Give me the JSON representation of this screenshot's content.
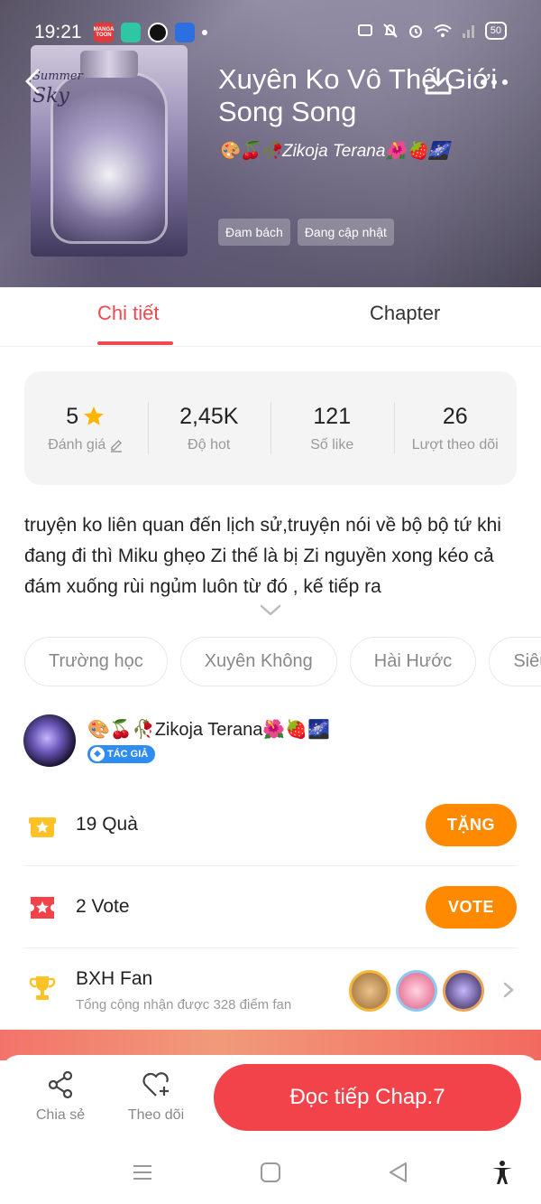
{
  "status_bar": {
    "time": "19:21",
    "battery": "50",
    "apps": [
      "MANGA TOON",
      "",
      "",
      ""
    ]
  },
  "book": {
    "title": "Xuyên Ko Vô Thế Giới Song Song",
    "author": "🎨🍒🥀Zikoja Terana🌺🍓🌌",
    "genres": [
      "Đam bách",
      "Đang cập nhật"
    ],
    "cover_text": [
      "Summer",
      "Sky"
    ]
  },
  "tabs": {
    "detail": "Chi tiết",
    "chapter": "Chapter"
  },
  "stats": {
    "rating": {
      "value": "5",
      "label": "Đánh giá"
    },
    "hot": {
      "value": "2,45K",
      "label": "Độ hot"
    },
    "likes": {
      "value": "121",
      "label": "Số like"
    },
    "follows": {
      "value": "26",
      "label": "Lượt theo dõi"
    }
  },
  "description": "truyện ko liên quan đến lịch sử,truyện nói về bộ bộ tứ khi đang đi thì Miku ghẹo Zi thế là bị Zi nguyền xong kéo cả đám xuống rùi ngủm luôn từ đó , kế tiếp ra",
  "tags": [
    "Trường học",
    "Xuyên Không",
    "Hài Hước",
    "Siêu n"
  ],
  "author_section": {
    "name": "🎨🍒🥀Zikoja Terana🌺🍓🌌",
    "badge": "TÁC GIẢ"
  },
  "gift": {
    "text": "19  Quà",
    "button": "TẶNG"
  },
  "vote": {
    "text": "2  Vote",
    "button": "VOTE"
  },
  "fan": {
    "title": "BXH Fan",
    "subtitle": "Tổng cộng nhận được 328 điểm fan"
  },
  "bottom_bar": {
    "share": "Chia sẻ",
    "follow": "Theo dõi",
    "read": "Đọc tiếp Chap.7"
  },
  "colors": {
    "accent": "#ef4850",
    "orange": "#ff8a00",
    "read_button": "#f2434b"
  }
}
